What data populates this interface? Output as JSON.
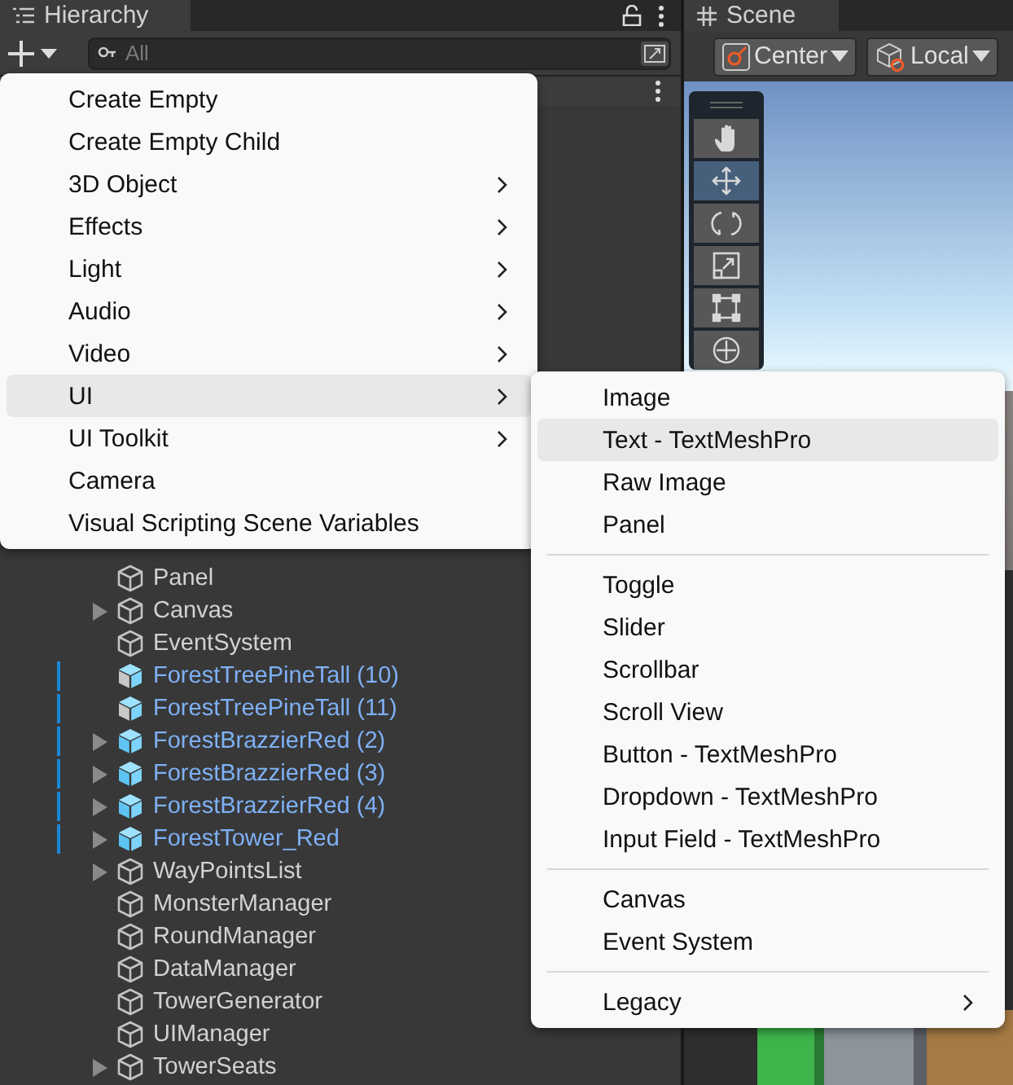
{
  "hierarchy": {
    "title": "Hierarchy",
    "search": {
      "placeholder": "All"
    },
    "rows": [
      {
        "label": "Panel",
        "kind": "object",
        "expandable": false
      },
      {
        "label": "Canvas",
        "kind": "object",
        "expandable": true
      },
      {
        "label": "EventSystem",
        "kind": "object",
        "expandable": false
      },
      {
        "label": "ForestTreePineTall (10)",
        "kind": "variant",
        "expandable": false
      },
      {
        "label": "ForestTreePineTall (11)",
        "kind": "variant",
        "expandable": false
      },
      {
        "label": "ForestBrazzierRed (2)",
        "kind": "prefab",
        "expandable": true
      },
      {
        "label": "ForestBrazzierRed (3)",
        "kind": "prefab",
        "expandable": true
      },
      {
        "label": "ForestBrazzierRed (4)",
        "kind": "prefab",
        "expandable": true
      },
      {
        "label": "ForestTower_Red",
        "kind": "prefab",
        "expandable": true
      },
      {
        "label": "WayPointsList",
        "kind": "object",
        "expandable": true
      },
      {
        "label": "MonsterManager",
        "kind": "object",
        "expandable": false
      },
      {
        "label": "RoundManager",
        "kind": "object",
        "expandable": false
      },
      {
        "label": "DataManager",
        "kind": "object",
        "expandable": false
      },
      {
        "label": "TowerGenerator",
        "kind": "object",
        "expandable": false
      },
      {
        "label": "UIManager",
        "kind": "object",
        "expandable": false
      },
      {
        "label": "TowerSeats",
        "kind": "object",
        "expandable": true
      }
    ]
  },
  "scene": {
    "title": "Scene",
    "pivot": "Center",
    "space": "Local",
    "tools": [
      {
        "kind": "hand",
        "selected": false
      },
      {
        "kind": "move",
        "selected": true
      },
      {
        "kind": "rotate",
        "selected": false
      },
      {
        "kind": "scale",
        "selected": false
      },
      {
        "kind": "rect",
        "selected": false
      },
      {
        "kind": "transform",
        "selected": false
      }
    ]
  },
  "create_menu": [
    {
      "label": "Create Empty",
      "submenu": false,
      "selected": false
    },
    {
      "label": "Create Empty Child",
      "submenu": false,
      "selected": false
    },
    {
      "label": "3D Object",
      "submenu": true,
      "selected": false
    },
    {
      "label": "Effects",
      "submenu": true,
      "selected": false
    },
    {
      "label": "Light",
      "submenu": true,
      "selected": false
    },
    {
      "label": "Audio",
      "submenu": true,
      "selected": false
    },
    {
      "label": "Video",
      "submenu": true,
      "selected": false
    },
    {
      "label": "UI",
      "submenu": true,
      "selected": true
    },
    {
      "label": "UI Toolkit",
      "submenu": true,
      "selected": false
    },
    {
      "label": "Camera",
      "submenu": false,
      "selected": false
    },
    {
      "label": "Visual Scripting Scene Variables",
      "submenu": false,
      "selected": false
    }
  ],
  "ui_submenu": [
    {
      "kind": "item",
      "label": "Image",
      "submenu": false,
      "selected": false
    },
    {
      "kind": "item",
      "label": "Text - TextMeshPro",
      "submenu": false,
      "selected": true
    },
    {
      "kind": "item",
      "label": "Raw Image",
      "submenu": false,
      "selected": false
    },
    {
      "kind": "item",
      "label": "Panel",
      "submenu": false,
      "selected": false
    },
    {
      "kind": "separator"
    },
    {
      "kind": "item",
      "label": "Toggle",
      "submenu": false,
      "selected": false
    },
    {
      "kind": "item",
      "label": "Slider",
      "submenu": false,
      "selected": false
    },
    {
      "kind": "item",
      "label": "Scrollbar",
      "submenu": false,
      "selected": false
    },
    {
      "kind": "item",
      "label": "Scroll View",
      "submenu": false,
      "selected": false
    },
    {
      "kind": "item",
      "label": "Button - TextMeshPro",
      "submenu": false,
      "selected": false
    },
    {
      "kind": "item",
      "label": "Dropdown - TextMeshPro",
      "submenu": false,
      "selected": false
    },
    {
      "kind": "item",
      "label": "Input Field - TextMeshPro",
      "submenu": false,
      "selected": false
    },
    {
      "kind": "separator"
    },
    {
      "kind": "item",
      "label": "Canvas",
      "submenu": false,
      "selected": false
    },
    {
      "kind": "item",
      "label": "Event System",
      "submenu": false,
      "selected": false
    },
    {
      "kind": "separator"
    },
    {
      "kind": "item",
      "label": "Legacy",
      "submenu": true,
      "selected": false
    }
  ]
}
